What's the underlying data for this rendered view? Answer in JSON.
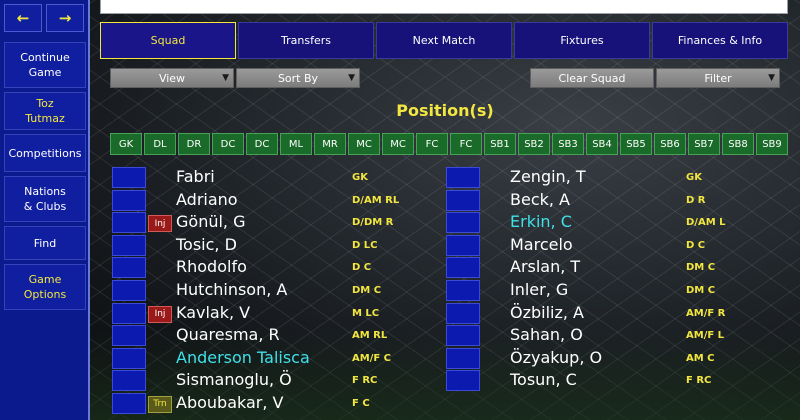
{
  "sidebar": {
    "arrows": [
      "←",
      "→"
    ],
    "items": [
      {
        "label": "Continue\nGame",
        "highlight": false
      },
      {
        "label": "Toz\nTutmaz",
        "highlight": true
      },
      {
        "label": "Competitions",
        "highlight": false
      },
      {
        "label": "Nations\n& Clubs",
        "highlight": false
      },
      {
        "label": "Find",
        "highlight": false
      },
      {
        "label": "Game\nOptions",
        "highlight": true
      }
    ]
  },
  "tabs": [
    {
      "label": "Squad",
      "active": true
    },
    {
      "label": "Transfers",
      "active": false
    },
    {
      "label": "Next Match",
      "active": false
    },
    {
      "label": "Fixtures",
      "active": false
    },
    {
      "label": "Finances & Info",
      "active": false
    }
  ],
  "controls": {
    "view": "View",
    "sort_by": "Sort By",
    "clear_squad": "Clear Squad",
    "filter": "Filter"
  },
  "heading": "Position(s)",
  "positions": [
    "GK",
    "DL",
    "DR",
    "DC",
    "DC",
    "ML",
    "MR",
    "MC",
    "MC",
    "FC",
    "FC",
    "SB1",
    "SB2",
    "SB3",
    "SB4",
    "SB5",
    "SB6",
    "SB7",
    "SB8",
    "SB9"
  ],
  "players_left": [
    {
      "name": "Fabri",
      "pos": "GK",
      "badge": "",
      "color": "#ffffff"
    },
    {
      "name": "Adriano",
      "pos": "D/AM RL",
      "badge": "",
      "color": "#ffffff"
    },
    {
      "name": "Gönül, G",
      "pos": "D/DM R",
      "badge": "Inj",
      "color": "#ffffff"
    },
    {
      "name": "Tosic, D",
      "pos": "D LC",
      "badge": "",
      "color": "#ffffff"
    },
    {
      "name": "Rhodolfo",
      "pos": "D C",
      "badge": "",
      "color": "#ffffff"
    },
    {
      "name": "Hutchinson, A",
      "pos": "DM C",
      "badge": "",
      "color": "#ffffff"
    },
    {
      "name": "Kavlak, V",
      "pos": "M LC",
      "badge": "Inj",
      "color": "#ffffff"
    },
    {
      "name": "Quaresma, R",
      "pos": "AM RL",
      "badge": "",
      "color": "#ffffff"
    },
    {
      "name": "Anderson Talisca",
      "pos": "AM/F C",
      "badge": "",
      "color": "#3fe0e8"
    },
    {
      "name": "Sismanoglu, Ö",
      "pos": "F RC",
      "badge": "",
      "color": "#ffffff"
    },
    {
      "name": "Aboubakar, V",
      "pos": "F C",
      "badge": "Trn",
      "color": "#ffffff"
    }
  ],
  "players_right": [
    {
      "name": "Zengin, T",
      "pos": "GK",
      "badge": "",
      "color": "#ffffff"
    },
    {
      "name": "Beck, A",
      "pos": "D R",
      "badge": "",
      "color": "#ffffff"
    },
    {
      "name": "Erkin, C",
      "pos": "D/AM L",
      "badge": "",
      "color": "#3fe0e8"
    },
    {
      "name": "Marcelo",
      "pos": "D C",
      "badge": "",
      "color": "#ffffff"
    },
    {
      "name": "Arslan, T",
      "pos": "DM C",
      "badge": "",
      "color": "#ffffff"
    },
    {
      "name": "Inler, G",
      "pos": "DM C",
      "badge": "",
      "color": "#ffffff"
    },
    {
      "name": "Özbiliz, A",
      "pos": "AM/F R",
      "badge": "",
      "color": "#ffffff"
    },
    {
      "name": "Sahan, O",
      "pos": "AM/F L",
      "badge": "",
      "color": "#ffffff"
    },
    {
      "name": "Özyakup, O",
      "pos": "AM C",
      "badge": "",
      "color": "#ffffff"
    },
    {
      "name": "Tosun, C",
      "pos": "F RC",
      "badge": "",
      "color": "#ffffff"
    }
  ]
}
